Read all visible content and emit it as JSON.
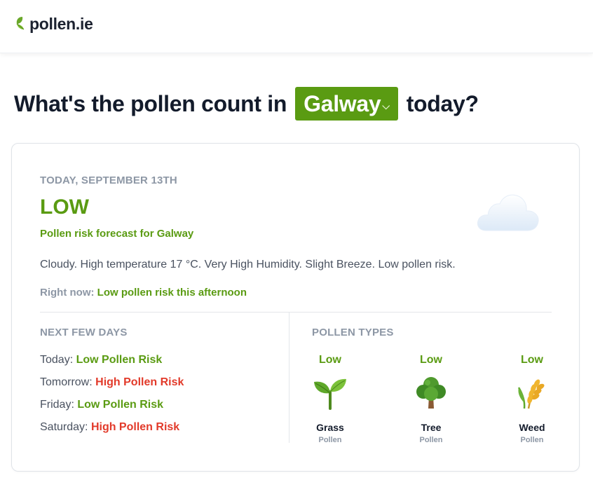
{
  "header": {
    "logo_text": "pollen.ie"
  },
  "headline": {
    "prefix": "What's the pollen count in",
    "city": "Galway",
    "suffix": "today?"
  },
  "today": {
    "date": "TODAY, SEPTEMBER 13TH",
    "level": "LOW",
    "forecast_for": "Pollen risk forecast for Galway",
    "description": "Cloudy. High temperature 17 °C. Very High Humidity. Slight Breeze. Low pollen risk.",
    "right_now_label": "Right now:",
    "right_now_value": "Low pollen risk this afternoon",
    "weather_icon": "cloud-icon"
  },
  "next_days": {
    "title": "NEXT FEW DAYS",
    "items": [
      {
        "day": "Today:",
        "risk": "Low Pollen Risk",
        "level": "low"
      },
      {
        "day": "Tomorrow:",
        "risk": "High Pollen Risk",
        "level": "high"
      },
      {
        "day": "Friday:",
        "risk": "Low Pollen Risk",
        "level": "low"
      },
      {
        "day": "Saturday:",
        "risk": "High Pollen Risk",
        "level": "high"
      }
    ]
  },
  "pollen_types": {
    "title": "POLLEN TYPES",
    "items": [
      {
        "level": "Low",
        "name": "Grass",
        "sub": "Pollen",
        "icon": "seedling-icon"
      },
      {
        "level": "Low",
        "name": "Tree",
        "sub": "Pollen",
        "icon": "tree-icon"
      },
      {
        "level": "Low",
        "name": "Weed",
        "sub": "Pollen",
        "icon": "wheat-icon"
      }
    ]
  },
  "colors": {
    "brand_green": "#5a9b12",
    "high_red": "#e23a2a",
    "muted": "#8d97a5"
  }
}
